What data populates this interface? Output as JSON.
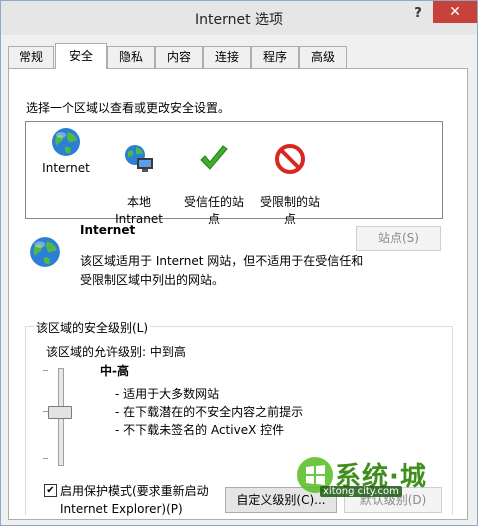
{
  "window": {
    "title": "Internet 选项",
    "help_label": "?",
    "close_label": "✕"
  },
  "tabs": [
    {
      "label": "常规"
    },
    {
      "label": "安全"
    },
    {
      "label": "隐私"
    },
    {
      "label": "内容"
    },
    {
      "label": "连接"
    },
    {
      "label": "程序"
    },
    {
      "label": "高级"
    }
  ],
  "active_tab": "安全",
  "zone_prompt": "选择一个区域以查看或更改安全设置。",
  "zones": [
    {
      "label": "Internet",
      "icon": "globe-icon"
    },
    {
      "label": "本地\nIntranet",
      "icon": "intranet-icon"
    },
    {
      "label": "受信任的站\n点",
      "icon": "checkmark-icon"
    },
    {
      "label": "受限制的站\n点",
      "icon": "restricted-icon"
    }
  ],
  "selected_zone": {
    "title": "Internet",
    "description": "该区域适用于 Internet 网站，但不适用于在受信任和受限制区域中列出的网站。",
    "sites_button": "站点(S)"
  },
  "security_level": {
    "group_title": "该区域的安全级别(L)",
    "allowed_levels": "该区域的允许级别: 中到高",
    "level_name": "中-高",
    "slider_level_fraction": 0.5,
    "bullets": [
      "- 适用于大多数网站",
      "- 在下载潜在的不安全内容之前提示",
      "- 不下载未签名的 ActiveX 控件"
    ]
  },
  "protected_mode": {
    "checked": true,
    "check_glyph": "✔",
    "label": "启用保护模式(要求重新启动 Internet Explorer)(P)"
  },
  "buttons": {
    "custom_level": "自定义级别(C)...",
    "default_level": "默认级别(D)"
  },
  "watermark": {
    "text": "系统·城",
    "url": "xitong city.com"
  },
  "colors": {
    "close_red": "#c7423a",
    "check_green": "#3fae2a",
    "restricted_red": "#d9281f",
    "watermark_green": "#3f8f1c"
  }
}
